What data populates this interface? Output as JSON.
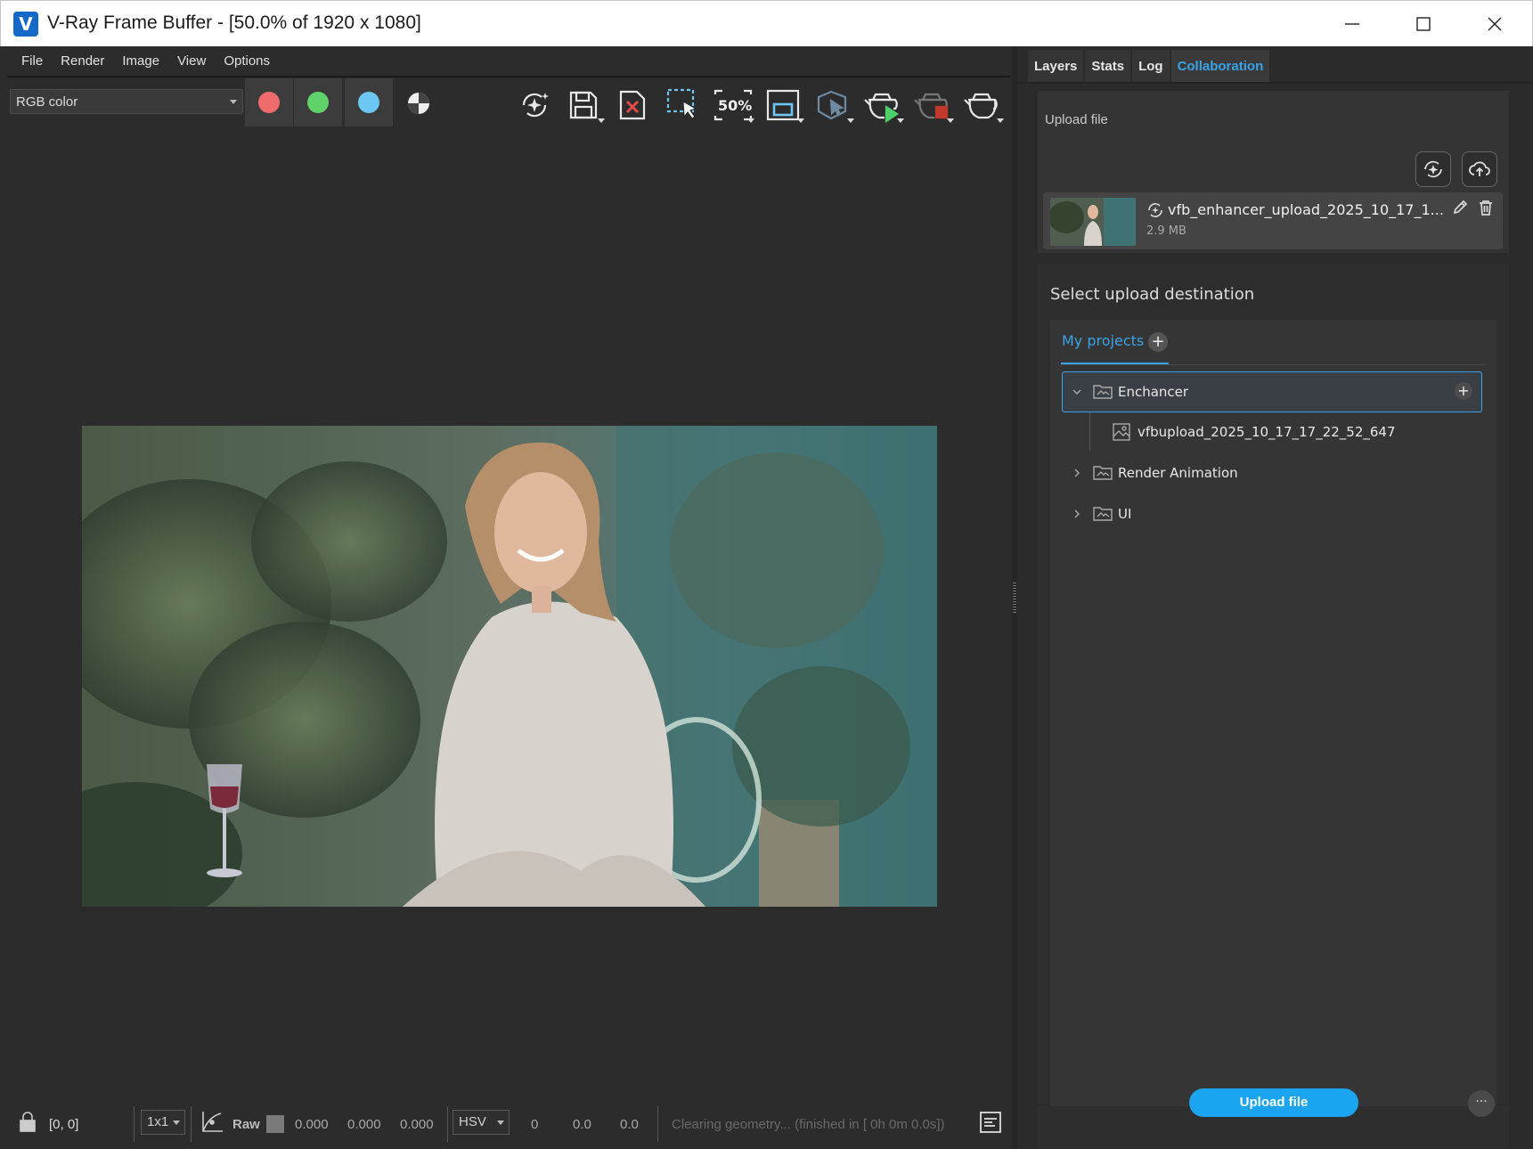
{
  "window": {
    "title": "V-Ray Frame Buffer - [50.0% of 1920 x 1080]",
    "controls": [
      "minimize-icon",
      "maximize-icon",
      "close-icon"
    ]
  },
  "menu": [
    "File",
    "Render",
    "Image",
    "View",
    "Options"
  ],
  "toolbar": {
    "channel": "RGB color",
    "channel_colors": {
      "red": "#f06060",
      "green": "#5fd36a",
      "blue": "#6cc7f5"
    },
    "zoom_label": "50%",
    "tools": [
      "ai-enhance-icon",
      "save-icon",
      "clear-image-icon",
      "region-select-icon",
      "zoom-icon",
      "region-render-icon",
      "track-mouse-icon",
      "render-interactive-icon",
      "stop-render-icon",
      "render-icon"
    ]
  },
  "status": {
    "coords": "[0, 0]",
    "sample": "1x1",
    "raw_label": "Raw",
    "rgb": [
      "0.000",
      "0.000",
      "0.000"
    ],
    "color_mode": "HSV",
    "hsv": [
      "0",
      "0.0",
      "0.0"
    ],
    "message": "Clearing geometry... (finished in [ 0h  0m  0.0s])"
  },
  "panel": {
    "tabs": [
      "Layers",
      "Stats",
      "Log",
      "Collaboration"
    ],
    "active_tab": "Collaboration",
    "upload_label": "Upload file",
    "file": {
      "name": "vfb_enhancer_upload_2025_10_17_1...",
      "size": "2.9 MB"
    },
    "destination_title": "Select upload destination",
    "projects_tab": "My projects",
    "tree": [
      {
        "label": "Enchancer",
        "type": "folder",
        "expanded": true,
        "selected": true
      },
      {
        "label": "vfbupload_2025_10_17_17_22_52_647",
        "type": "image",
        "child": true
      },
      {
        "label": "Render Animation",
        "type": "folder",
        "expanded": false
      },
      {
        "label": "UI",
        "type": "folder",
        "expanded": false
      }
    ],
    "upload_button": "Upload file",
    "more_button": "···"
  },
  "colors": {
    "accent": "#3aa3e8",
    "button": "#1ba5f0",
    "bg": "#2c2c2c"
  }
}
